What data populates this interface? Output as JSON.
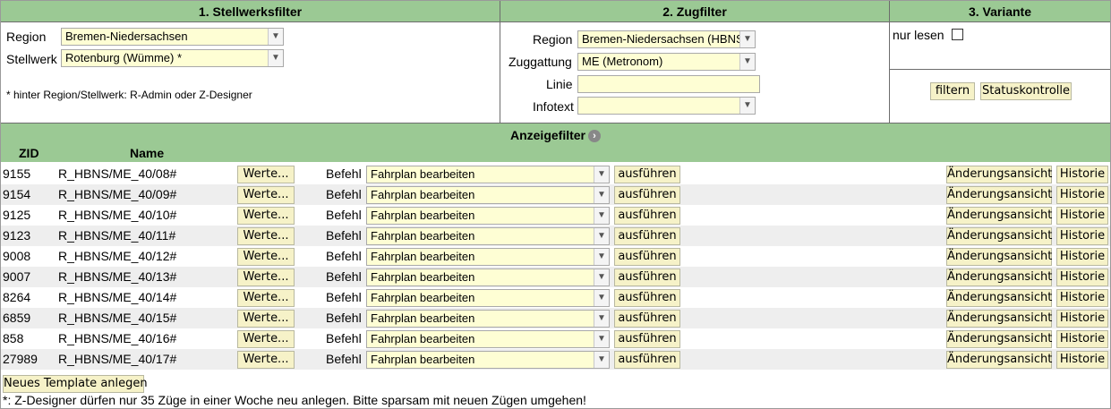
{
  "headers": {
    "filter1": "1. Stellwerksfilter",
    "filter2": "2. Zugfilter",
    "filter3": "3. Variante"
  },
  "stellwerk": {
    "region_label": "Region",
    "region_value": "Bremen-Niedersachsen",
    "stellwerk_label": "Stellwerk",
    "stellwerk_value": "Rotenburg (Wümme) *",
    "note": "* hinter Region/Stellwerk: R-Admin oder Z-Designer"
  },
  "zug": {
    "region_label": "Region",
    "region_value": "Bremen-Niedersachsen (HBNS)",
    "gattung_label": "Zuggattung",
    "gattung_value": "ME (Metronom)",
    "linie_label": "Linie",
    "linie_value": "",
    "infotext_label": "Infotext",
    "infotext_value": ""
  },
  "variante": {
    "nur_lesen_label": "nur lesen",
    "nur_lesen_checked": false,
    "filter_button": "filtern",
    "status_button": "Statuskontrolle"
  },
  "anzeige": {
    "title": "Anzeigefilter",
    "info_icon": "chevron-right-icon",
    "col_zid": "ZID",
    "col_name": "Name"
  },
  "row_labels": {
    "werte": "Werte...",
    "befehl": "Befehl",
    "ausfuehren": "ausführen",
    "aenderung": "Änderungsansicht",
    "historie": "Historie"
  },
  "rows": [
    {
      "zid": "9155",
      "name": "R_HBNS/ME_40/08#",
      "befehl": "Fahrplan bearbeiten"
    },
    {
      "zid": "9154",
      "name": "R_HBNS/ME_40/09#",
      "befehl": "Fahrplan bearbeiten"
    },
    {
      "zid": "9125",
      "name": "R_HBNS/ME_40/10#",
      "befehl": "Fahrplan bearbeiten"
    },
    {
      "zid": "9123",
      "name": "R_HBNS/ME_40/11#",
      "befehl": "Fahrplan bearbeiten"
    },
    {
      "zid": "9008",
      "name": "R_HBNS/ME_40/12#",
      "befehl": "Fahrplan bearbeiten"
    },
    {
      "zid": "9007",
      "name": "R_HBNS/ME_40/13#",
      "befehl": "Fahrplan bearbeiten"
    },
    {
      "zid": "8264",
      "name": "R_HBNS/ME_40/14#",
      "befehl": "Fahrplan bearbeiten"
    },
    {
      "zid": "6859",
      "name": "R_HBNS/ME_40/15#",
      "befehl": "Fahrplan bearbeiten"
    },
    {
      "zid": "858",
      "name": "R_HBNS/ME_40/16#",
      "befehl": "Fahrplan bearbeiten"
    },
    {
      "zid": "27989",
      "name": "R_HBNS/ME_40/17#",
      "befehl": "Fahrplan bearbeiten"
    }
  ],
  "footer": {
    "new_template_button": "Neues Template anlegen",
    "note": "*: Z-Designer dürfen nur 35 Züge in einer Woche neu anlegen. Bitte sparsam mit neuen Zügen umgehen!"
  },
  "colors": {
    "header_green": "#9bc994",
    "input_yellow": "#fefed4",
    "button_yellow": "#f6f2c8",
    "row_alt": "#eeeeee"
  }
}
